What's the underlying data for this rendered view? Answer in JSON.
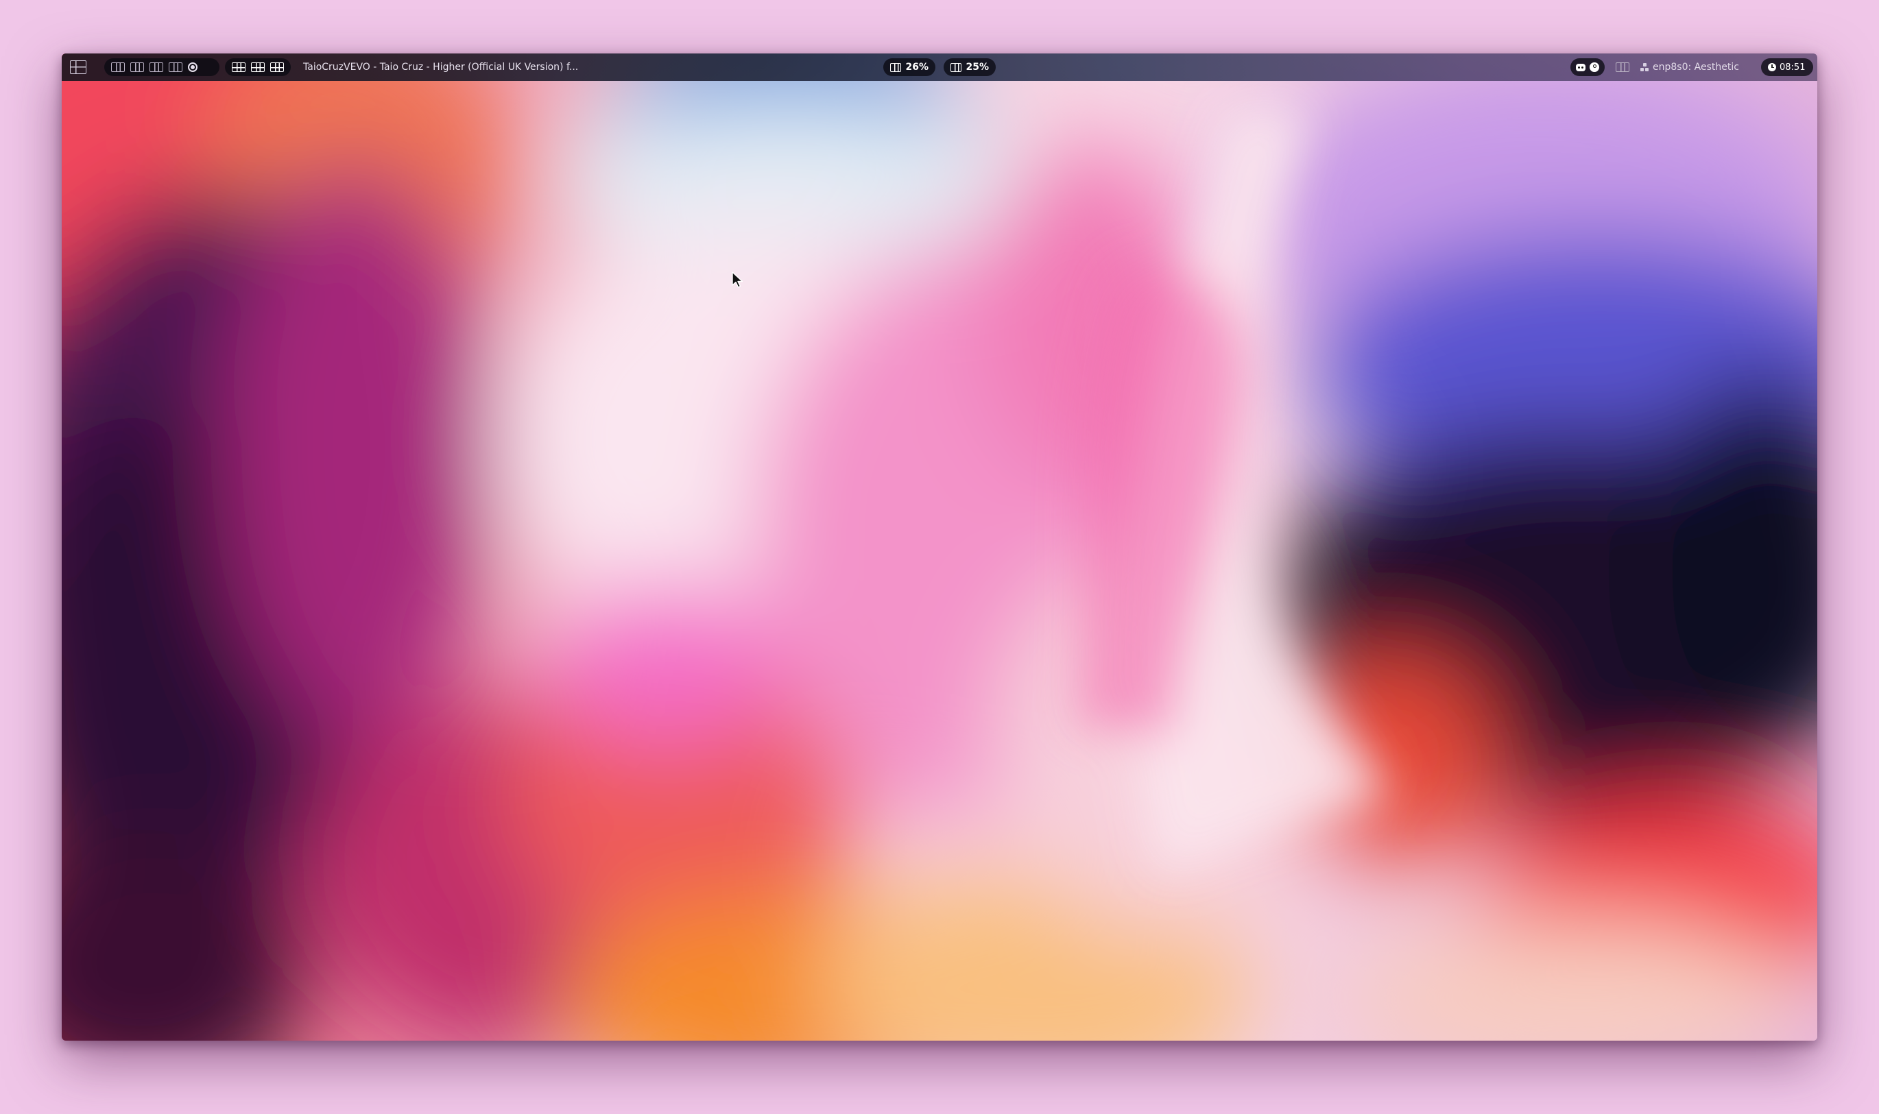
{
  "topbar": {
    "window_title": "TaioCruzVEVO - Taio Cruz - Higher (Official UK Version) f...",
    "cpu_usage": "26%",
    "mem_usage": "25%",
    "network_label": "enp8s0: Aesthetic",
    "clock": "08:51"
  },
  "icons": {
    "launcher": "grid-launcher-icon",
    "workspaces": [
      "workspace-1-icon",
      "workspace-2-icon",
      "workspace-3-icon",
      "workspace-4-icon"
    ],
    "record": "record-icon",
    "layouts": [
      "layout-tile-icon",
      "layout-grid-icon",
      "layout-monocle-icon"
    ],
    "tray": [
      "discord-icon",
      "steam-icon"
    ]
  },
  "colors": {
    "frame_background": "#f0c6e8",
    "bar_text": "#e8e2ee",
    "pill_background": "#0a0a12"
  }
}
